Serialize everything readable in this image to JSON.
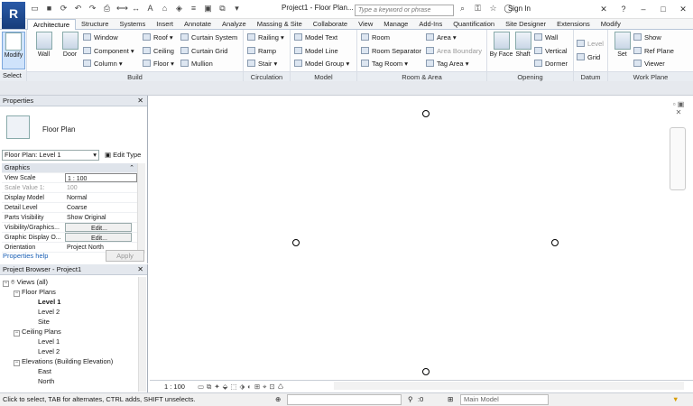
{
  "titlebar": {
    "logo": "R",
    "title": "Project1 - Floor Plan...",
    "search_placeholder": "Type a keyword or phrase",
    "signin": "Sign In"
  },
  "tabs": [
    "Architecture",
    "Structure",
    "Systems",
    "Insert",
    "Annotate",
    "Analyze",
    "Massing & Site",
    "Collaborate",
    "View",
    "Manage",
    "Add-Ins",
    "Quantification",
    "Site Designer",
    "Extensions",
    "Modify"
  ],
  "ribbon": {
    "select_label": "Select",
    "modify": "Modify",
    "panels": {
      "build": "Build",
      "circulation": "Circulation",
      "model": "Model",
      "room_area": "Room & Area",
      "opening": "Opening",
      "datum": "Datum",
      "work_plane": "Work Plane"
    },
    "build": {
      "wall": "Wall",
      "door": "Door",
      "window": "Window",
      "component": "Component",
      "column": "Column",
      "roof": "Roof",
      "ceiling": "Ceiling",
      "floor": "Floor",
      "curtain_system": "Curtain System",
      "curtain_grid": "Curtain Grid",
      "mullion": "Mullion"
    },
    "circulation": {
      "railing": "Railing",
      "ramp": "Ramp",
      "stair": "Stair"
    },
    "model": {
      "model_text": "Model Text",
      "model_line": "Model Line",
      "model_group": "Model Group"
    },
    "room_area": {
      "room": "Room",
      "room_separator": "Room Separator",
      "tag_room": "Tag Room",
      "area": "Area",
      "area_boundary": "Area Boundary",
      "tag_area": "Tag Area"
    },
    "opening": {
      "by_face": "By Face",
      "shaft": "Shaft",
      "wall": "Wall",
      "vertical": "Vertical",
      "dormer": "Dormer"
    },
    "datum": {
      "level": "Level",
      "grid": "Grid"
    },
    "work_plane": {
      "set": "Set",
      "show": "Show",
      "ref_plane": "Ref Plane",
      "viewer": "Viewer"
    }
  },
  "properties": {
    "title": "Properties",
    "type_name": "Floor Plan",
    "instance_selector": "Floor Plan: Level 1",
    "edit_type": "Edit Type",
    "rows": [
      {
        "k": "Graphics",
        "v": "",
        "group": true
      },
      {
        "k": "View Scale",
        "v": "1 : 100"
      },
      {
        "k": "Scale Value    1:",
        "v": "100",
        "grey": true
      },
      {
        "k": "Display Model",
        "v": "Normal"
      },
      {
        "k": "Detail Level",
        "v": "Coarse"
      },
      {
        "k": "Parts Visibility",
        "v": "Show Original"
      },
      {
        "k": "Visibility/Graphics...",
        "v": "Edit...",
        "btn": true
      },
      {
        "k": "Graphic Display O...",
        "v": "Edit...",
        "btn": true
      },
      {
        "k": "Orientation",
        "v": "Project North"
      }
    ],
    "help": "Properties help",
    "apply": "Apply"
  },
  "browser": {
    "title": "Project Browser - Project1",
    "nodes": [
      {
        "label": "Views (all)",
        "indent": 0,
        "exp": "−"
      },
      {
        "label": "Floor Plans",
        "indent": 1,
        "exp": "−"
      },
      {
        "label": "Level 1",
        "indent": 2,
        "bold": true
      },
      {
        "label": "Level 2",
        "indent": 2
      },
      {
        "label": "Site",
        "indent": 2
      },
      {
        "label": "Ceiling Plans",
        "indent": 1,
        "exp": "−"
      },
      {
        "label": "Level 1",
        "indent": 2
      },
      {
        "label": "Level 2",
        "indent": 2
      },
      {
        "label": "Elevations (Building Elevation)",
        "indent": 1,
        "exp": "−"
      },
      {
        "label": "East",
        "indent": 2
      },
      {
        "label": "North",
        "indent": 2
      }
    ]
  },
  "viewbar": {
    "scale": "1 : 100"
  },
  "status": {
    "text": "Click to select, TAB for alternates, CTRL adds, SHIFT unselects.",
    "zero": ":0",
    "model": "Main Model"
  }
}
